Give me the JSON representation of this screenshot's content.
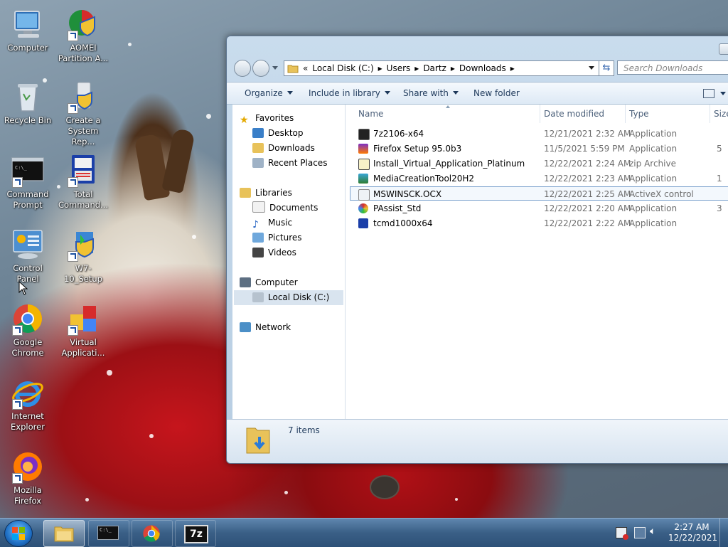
{
  "desktop": {
    "icons": [
      {
        "label": "Computer"
      },
      {
        "label": "AOMEI Partition A..."
      },
      {
        "label": "Recycle Bin"
      },
      {
        "label": "Create a System Rep..."
      },
      {
        "label": "Command Prompt"
      },
      {
        "label": "Total Command..."
      },
      {
        "label": "Control Panel"
      },
      {
        "label": "W7-10_Setup"
      },
      {
        "label": "Google Chrome"
      },
      {
        "label": "Virtual Applicati..."
      },
      {
        "label": "Internet Explorer"
      },
      {
        "label": "Mozilla Firefox"
      }
    ]
  },
  "explorer": {
    "address": {
      "overflow": "«",
      "crumbs": [
        "Local Disk (C:)",
        "Users",
        "Dartz",
        "Downloads"
      ],
      "separator": "▸"
    },
    "search_placeholder": "Search Downloads",
    "toolbar": {
      "organize": "Organize",
      "include_in_library": "Include in library",
      "share_with": "Share with",
      "new_folder": "New folder"
    },
    "nav": {
      "favorites": {
        "label": "Favorites",
        "items": [
          "Desktop",
          "Downloads",
          "Recent Places"
        ]
      },
      "libraries": {
        "label": "Libraries",
        "items": [
          "Documents",
          "Music",
          "Pictures",
          "Videos"
        ]
      },
      "computer": {
        "label": "Computer",
        "items": [
          "Local Disk (C:)"
        ]
      },
      "network": {
        "label": "Network"
      }
    },
    "columns": {
      "name": "Name",
      "date": "Date modified",
      "type": "Type",
      "size": "Size"
    },
    "files": [
      {
        "name": "7z2106-x64",
        "date": "12/21/2021 2:32 AM",
        "type": "Application",
        "size": ""
      },
      {
        "name": "Firefox Setup 95.0b3",
        "date": "11/5/2021 5:59 PM",
        "type": "Application",
        "size": "5"
      },
      {
        "name": "Install_Virtual_Application_Platinum",
        "date": "12/22/2021 2:24 AM",
        "type": "zip Archive",
        "size": ""
      },
      {
        "name": "MediaCreationTool20H2",
        "date": "12/22/2021 2:23 AM",
        "type": "Application",
        "size": "1"
      },
      {
        "name": "MSWINSCK.OCX",
        "date": "12/22/2021 2:25 AM",
        "type": "ActiveX control",
        "size": ""
      },
      {
        "name": "PAssist_Std",
        "date": "12/22/2021 2:20 AM",
        "type": "Application",
        "size": "3"
      },
      {
        "name": "tcmd1000x64",
        "date": "12/22/2021 2:22 AM",
        "type": "Application",
        "size": ""
      }
    ],
    "details": {
      "item_count": "7 items"
    }
  },
  "taskbar": {
    "clock_time": "2:27 AM",
    "clock_date": "12/22/2021",
    "cmd_label": "C:\\_",
    "sevenzip_label": "7z"
  },
  "colors": {
    "accent": "#3a6ab0",
    "selection": "#cce8ff"
  }
}
